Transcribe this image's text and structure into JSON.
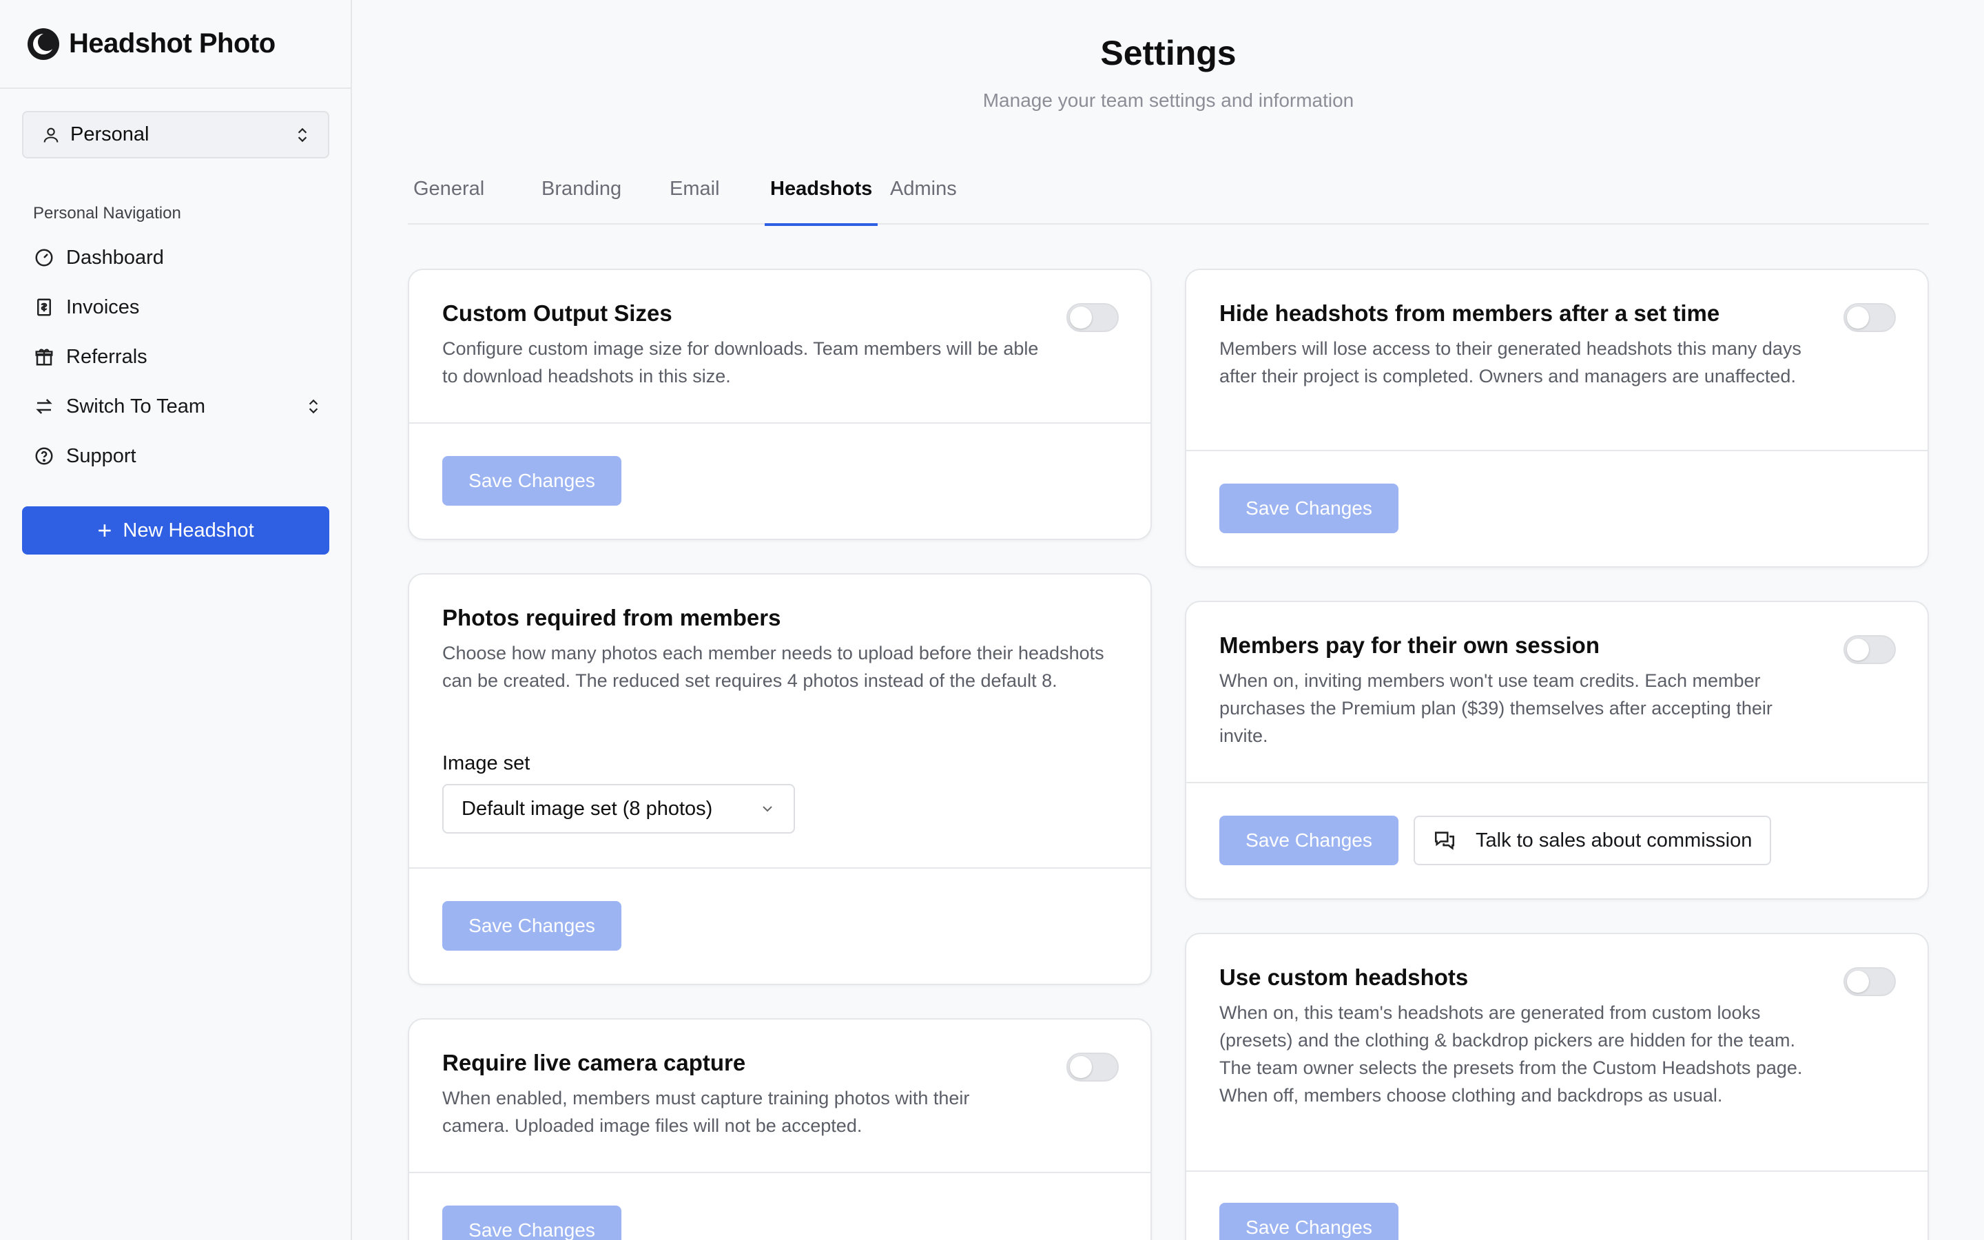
{
  "app": {
    "name": "Headshot Photo"
  },
  "workspace": {
    "selected": "Personal"
  },
  "sidebar": {
    "heading": "Personal Navigation",
    "items": [
      {
        "label": "Dashboard",
        "icon": "gauge-icon"
      },
      {
        "label": "Invoices",
        "icon": "receipt-icon"
      },
      {
        "label": "Referrals",
        "icon": "gift-icon"
      },
      {
        "label": "Switch To Team",
        "icon": "arrows-swap-icon"
      },
      {
        "label": "Support",
        "icon": "help-circle-icon"
      }
    ],
    "new_button": "New Headshot"
  },
  "page": {
    "title": "Settings",
    "subtitle": "Manage your team settings and information"
  },
  "tabs": [
    {
      "label": "General",
      "active": false
    },
    {
      "label": "Branding",
      "active": false
    },
    {
      "label": "Email",
      "active": false
    },
    {
      "label": "Headshots",
      "active": true
    },
    {
      "label": "Admins",
      "active": false
    }
  ],
  "cards": {
    "custom_output": {
      "title": "Custom Output Sizes",
      "description": "Configure custom image size for downloads. Team members will be able to download headshots in this size.",
      "toggle_on": false,
      "save": "Save Changes"
    },
    "photos_required": {
      "title": "Photos required from members",
      "description": "Choose how many photos each member needs to upload before their headshots can be created. The reduced set requires 4 photos instead of the default 8.",
      "field_label": "Image set",
      "select_value": "Default image set (8 photos)",
      "save": "Save Changes"
    },
    "live_capture": {
      "title": "Require live camera capture",
      "description": "When enabled, members must capture training photos with their camera. Uploaded image files will not be accepted.",
      "toggle_on": false,
      "save": "Save Changes"
    },
    "hide_headshots": {
      "title": "Hide headshots from members after a set time",
      "description": "Members will lose access to their generated headshots this many days after their project is completed. Owners and managers are unaffected.",
      "toggle_on": false,
      "save": "Save Changes"
    },
    "members_pay": {
      "title": "Members pay for their own session",
      "description": "When on, inviting members won't use team credits. Each member purchases the Premium plan ($39) themselves after accepting their invite.",
      "toggle_on": false,
      "save": "Save Changes",
      "sales": "Talk to sales about commission"
    },
    "custom_headshots": {
      "title": "Use custom headshots",
      "description": "When on, this team's headshots are generated from custom looks (presets) and the clothing & backdrop pickers are hidden for the team. The team owner selects the presets from the Custom Headshots page. When off, members choose clothing and backdrops as usual.",
      "toggle_on": false,
      "save": "Save Changes"
    }
  },
  "colors": {
    "accent": "#2f5fe3",
    "save_disabled": "#9db4f3",
    "background": "#f8f9fb"
  }
}
